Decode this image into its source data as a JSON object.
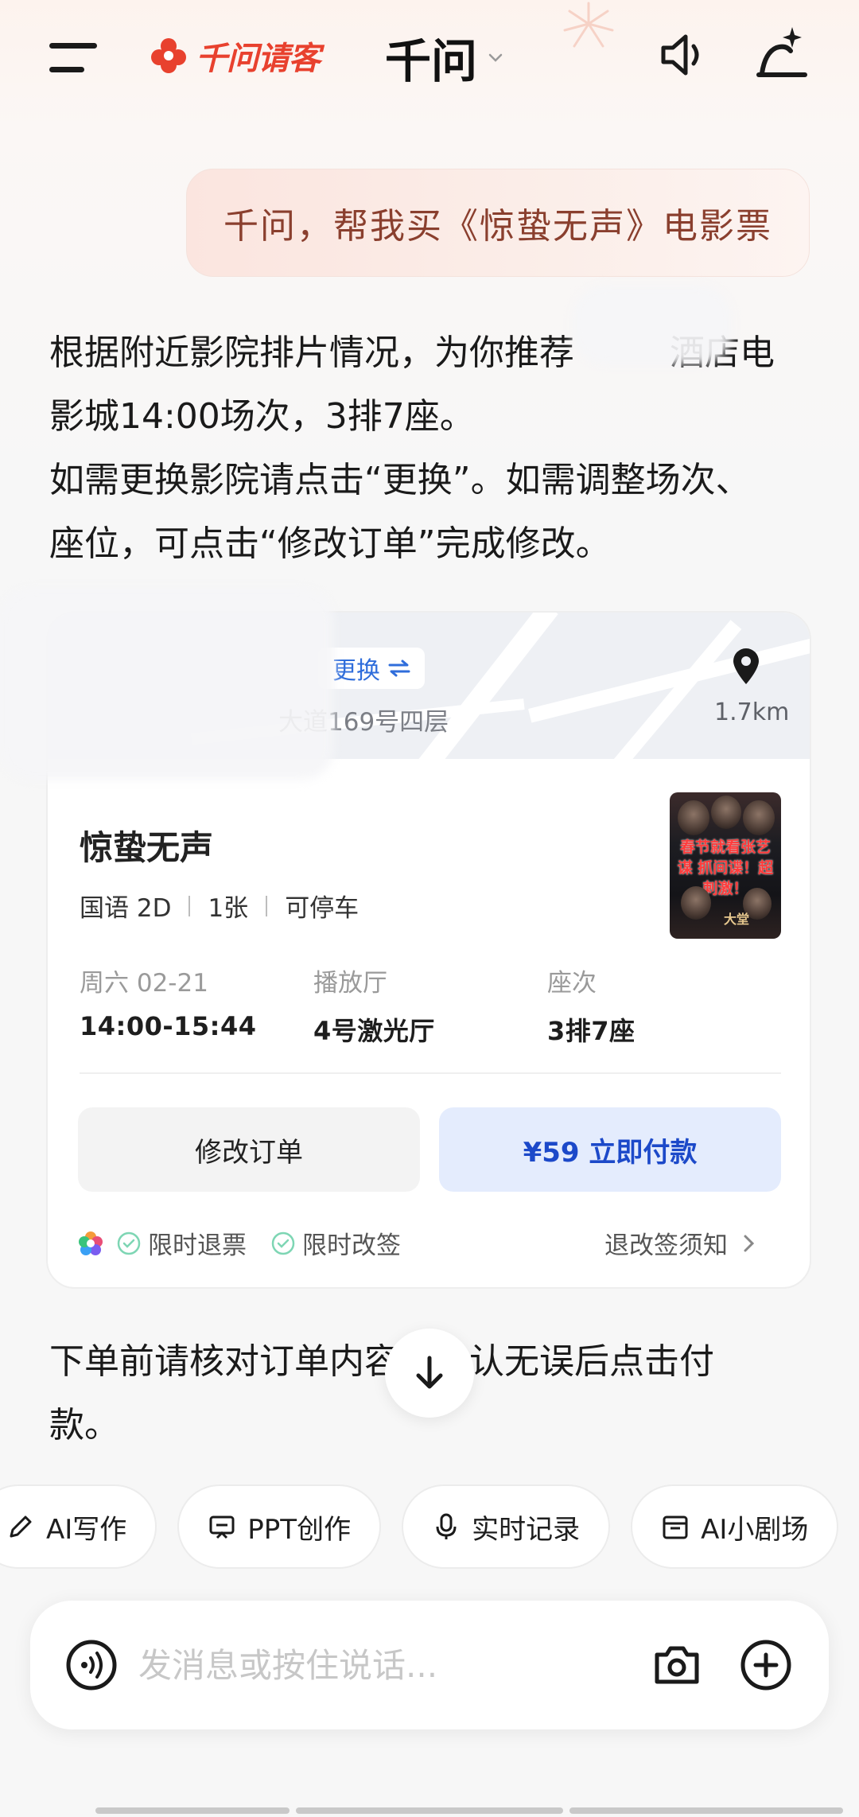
{
  "header": {
    "brand_label": "千问请客",
    "title": "千问"
  },
  "user_message": "千问，帮我买《惊蛰无声》电影票",
  "reply": {
    "line1": "根据附近影院排片情况，为你推荐",
    "line1_tail": "酒店电",
    "line2": "影城14:00场次，3排7座。",
    "line3": "如需更换影院请点击“更换”。如需调整场次、",
    "line4": "座位，可点击“修改订单”完成修改。"
  },
  "card": {
    "change_label": "更换",
    "address": "大道169号四层",
    "distance": "1.7km",
    "movie_title": "惊蛰无声",
    "tags": [
      "国语 2D",
      "1张",
      "可停车"
    ],
    "poster_text": "春节就看张艺谋 抓间谍！超刺激！",
    "poster_logo": "大堂",
    "date_label": "周六 02-21",
    "time_value": "14:00-15:44",
    "hall_label": "播放厅",
    "hall_value": "4号激光厅",
    "seat_label": "座次",
    "seat_value": "3排7座",
    "modify_button": "修改订单",
    "pay_button": "¥59 立即付款",
    "guarantee_1": "限时退票",
    "guarantee_2": "限时改签",
    "policy_link": "退改签须知"
  },
  "notice": {
    "line1": "下单前请核对订单内容，确认无误后点击付",
    "line2": "款。"
  },
  "chips": [
    {
      "label": "AI写作",
      "icon": "pen-icon"
    },
    {
      "label": "PPT创作",
      "icon": "presentation-icon"
    },
    {
      "label": "实时记录",
      "icon": "microphone-icon"
    },
    {
      "label": "AI小剧场",
      "icon": "theater-icon"
    }
  ],
  "composer": {
    "placeholder": "发消息或按住说话..."
  },
  "colors": {
    "brand_red": "#e8412e",
    "pay_blue": "#1c49c9",
    "pay_bg": "#e4ecfd",
    "bubble_text": "#8a3f2e"
  }
}
